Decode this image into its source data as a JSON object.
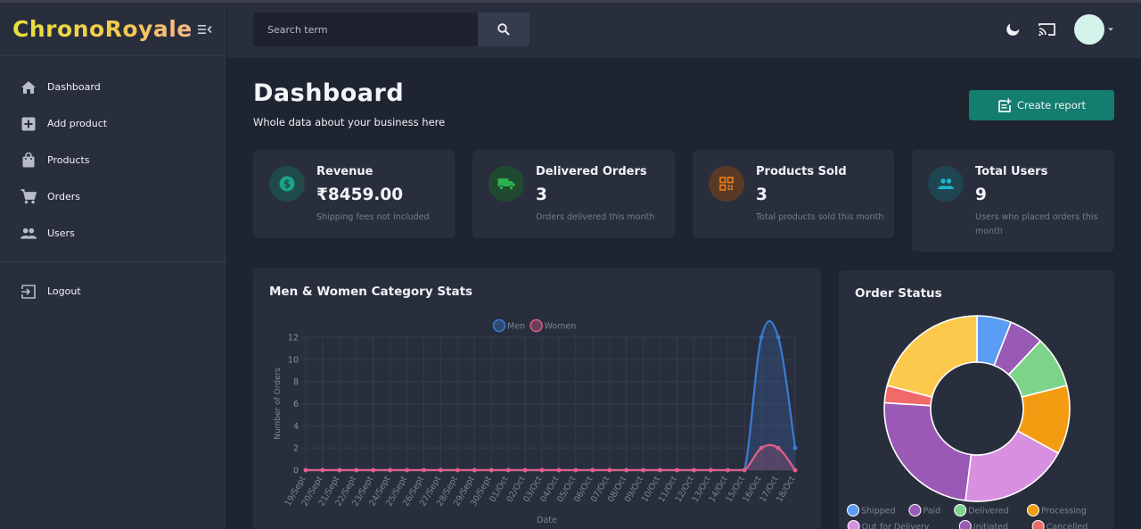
{
  "brand": {
    "name": "ChronoRoyale"
  },
  "search": {
    "placeholder": "Search term"
  },
  "sidebar": {
    "items": [
      {
        "label": "Dashboard",
        "icon": "home-icon"
      },
      {
        "label": "Add product",
        "icon": "add-box-icon"
      },
      {
        "label": "Products",
        "icon": "shopping-bag-icon"
      },
      {
        "label": "Orders",
        "icon": "cart-icon"
      },
      {
        "label": "Users",
        "icon": "people-icon"
      }
    ],
    "logout": {
      "label": "Logout",
      "icon": "logout-icon"
    }
  },
  "header": {
    "title": "Dashboard",
    "subtitle": "Whole data about your business here",
    "create_label": "Create report"
  },
  "stats": [
    {
      "title": "Revenue",
      "value": "₹8459.00",
      "note": "Shipping fees not included",
      "icon": "dollar-icon",
      "color": "#1aa389",
      "bg": "#1f4a47"
    },
    {
      "title": "Delivered Orders",
      "value": "3",
      "note": "Orders delivered this month",
      "icon": "truck-icon",
      "color": "#2eb04f",
      "bg": "#1f4a30"
    },
    {
      "title": "Products Sold",
      "value": "3",
      "note": "Total products sold this month",
      "icon": "qr-code-icon",
      "color": "#f07d1a",
      "bg": "#5a3a25"
    },
    {
      "title": "Total Users",
      "value": "9",
      "note": "Users who placed orders this month",
      "icon": "people-icon",
      "color": "#1bb6c9",
      "bg": "#1f4550"
    }
  ],
  "line_panel": {
    "title": "Men & Women Category Stats"
  },
  "pie_panel": {
    "title": "Order Status"
  },
  "chart_data": [
    {
      "type": "line",
      "title": "",
      "xlabel": "Date",
      "ylabel": "Number of Orders",
      "ylim": [
        0,
        12
      ],
      "yticks": [
        0,
        2,
        4,
        6,
        8,
        10,
        12
      ],
      "grid": true,
      "legend": "top-center",
      "categories": [
        "19/Sept",
        "20/Sept",
        "21/Sept",
        "22/Sept",
        "23/Sept",
        "24/Sept",
        "25/Sept",
        "26/Sept",
        "27/Sept",
        "28/Sept",
        "29/Sept",
        "30/Sept",
        "01/Oct",
        "02/Oct",
        "03/Oct",
        "04/Oct",
        "05/Oct",
        "06/Oct",
        "07/Oct",
        "08/Oct",
        "09/Oct",
        "10/Oct",
        "11/Oct",
        "12/Oct",
        "13/Oct",
        "14/Oct",
        "15/Oct",
        "16/Oct",
        "17/Oct",
        "18/Oct"
      ],
      "series": [
        {
          "name": "Men",
          "color": "#3a7bd5",
          "values": [
            0,
            0,
            0,
            0,
            0,
            0,
            0,
            0,
            0,
            0,
            0,
            0,
            0,
            0,
            0,
            0,
            0,
            0,
            0,
            0,
            0,
            0,
            0,
            0,
            0,
            0,
            0,
            12,
            12,
            2
          ]
        },
        {
          "name": "Women",
          "color": "#e05f88",
          "values": [
            0,
            0,
            0,
            0,
            0,
            0,
            0,
            0,
            0,
            0,
            0,
            0,
            0,
            0,
            0,
            0,
            0,
            0,
            0,
            0,
            0,
            0,
            0,
            0,
            0,
            0,
            0,
            2,
            2,
            0
          ]
        }
      ]
    },
    {
      "type": "pie",
      "title": "",
      "legend": "bottom",
      "slices": [
        {
          "label": "Shipped",
          "value": 6,
          "color": "#5b9df5"
        },
        {
          "label": "Paid",
          "value": 6,
          "color": "#9b59b6"
        },
        {
          "label": "Delivered",
          "value": 9,
          "color": "#7dd389"
        },
        {
          "label": "Processing",
          "value": 12,
          "color": "#f39c12"
        },
        {
          "label": "Out for Delivery",
          "value": 19,
          "color": "#d98fe0"
        },
        {
          "label": "Initiated",
          "value": 24,
          "color": "#9b59b6"
        },
        {
          "label": "Cancelled",
          "value": 3,
          "color": "#f06a6a"
        },
        {
          "label": "",
          "value": 21,
          "color": "#fcc94c"
        }
      ]
    }
  ]
}
